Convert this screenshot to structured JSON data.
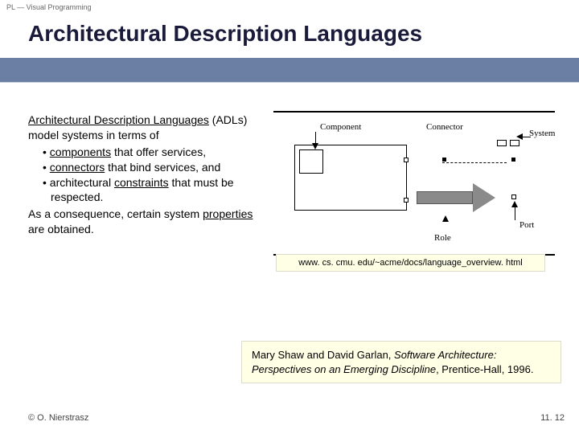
{
  "course_tag": "PL — Visual Programming",
  "title": "Architectural Description Languages",
  "body": {
    "lead1a": "Architectural Description Languages",
    "lead1b": " (ADLs) model systems in terms of",
    "b1_u": "components",
    "b1_rest": " that offer services,",
    "b2_u": "connectors",
    "b2_rest": " that bind services, and",
    "b3_pre": "architectural ",
    "b3_u": "constraints",
    "b3_rest": " that must be respected.",
    "tail_pre": "As a consequence, certain system ",
    "tail_u": "properties",
    "tail_post": " are obtained."
  },
  "diagram_labels": {
    "component": "Component",
    "connector": "Connector",
    "system": "System",
    "role": "Role",
    "port": "Port"
  },
  "url": "www. cs. cmu. edu/~acme/docs/language_overview. html",
  "citation": {
    "authors": "Mary Shaw and David Garlan, ",
    "title_italic": "Software Architecture: Perspectives on an Emerging Discipline",
    "rest": ", Prentice-Hall, 1996."
  },
  "footer": {
    "left": "© O. Nierstrasz",
    "right": "11. 12"
  }
}
